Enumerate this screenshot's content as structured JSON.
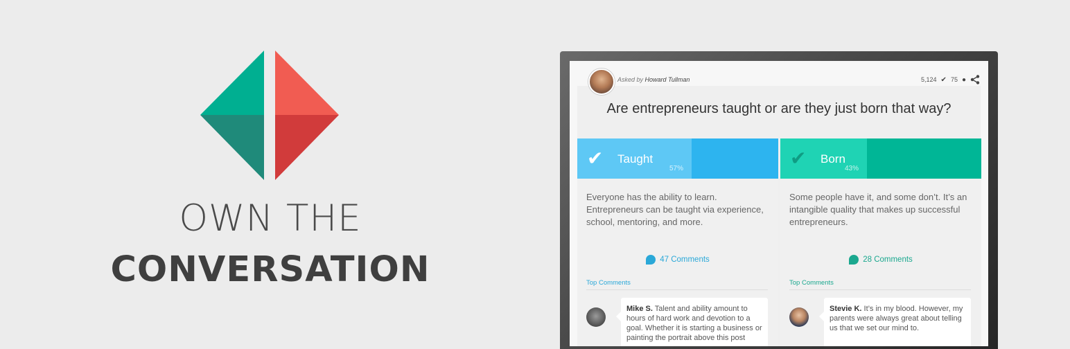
{
  "brand": {
    "tagline_line1": "OWN THE",
    "tagline_line2": "CONVERSATION",
    "logo_colors": [
      "#00af91",
      "#f15c52",
      "#1f8a7a",
      "#d13b3b"
    ]
  },
  "question_card": {
    "asked_prefix": "Asked by",
    "asker": "Howard Tullman",
    "votes": "5,124",
    "comments_count": "75",
    "question": "Are entrepreneurs taught or are they just born that way?"
  },
  "options": [
    {
      "label": "Taught",
      "percent_text": "57%",
      "percent": 57,
      "color_light": "#5ec8f5",
      "color_dark": "#2db4ef",
      "description": "Everyone has the ability to learn. Entrepreneurs can be taught via experience, school, mentoring, and more.",
      "comments_label": "47 Comments",
      "link_color": "#2aa8d8",
      "top_comments_label": "Top Comments",
      "top_comment_author": "Mike S.",
      "top_comment_text": "Talent and ability amount to hours of hard work and devotion to a goal. Whether it is starting a business or painting the portrait above this post"
    },
    {
      "label": "Born",
      "percent_text": "43%",
      "percent": 43,
      "color_light": "#1fd3b4",
      "color_dark": "#00b696",
      "description": "Some people have it, and some don’t. It’s an intangible quality that makes up successful entrepreneurs.",
      "comments_label": "28 Comments",
      "link_color": "#1ba88f",
      "top_comments_label": "Top Comments",
      "top_comment_author": "Stevie K.",
      "top_comment_text": "It’s in my blood. However, my parents were always great about telling us that we set our mind to."
    }
  ],
  "icons": {
    "check": "check-icon",
    "comment": "comment-bubble-icon",
    "share": "share-icon"
  }
}
